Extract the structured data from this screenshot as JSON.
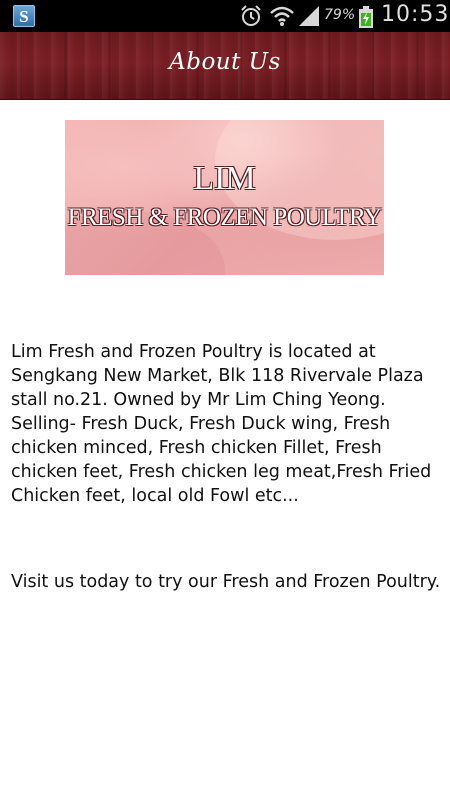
{
  "status_bar": {
    "app_icon_letter": "S",
    "battery_percent": "79%",
    "time": "10:53"
  },
  "header": {
    "title": "About Us"
  },
  "banner": {
    "line1": "LIM",
    "line2": "FRESH & FROZEN POULTRY"
  },
  "content": {
    "about": "Lim Fresh and Frozen Poultry is located at Sengkang New Market, Blk 118 Rivervale Plaza stall no.21. Owned by Mr Lim Ching Yeong. Selling- Fresh Duck, Fresh Duck wing, Fresh chicken minced, Fresh chicken Fillet, Fresh chicken feet, Fresh chicken leg meat,Fresh Fried Chicken feet, local old Fowl etc...",
    "visit": "Visit us today to try our Fresh and Frozen Poultry."
  },
  "colors": {
    "header_background": "#7c2025",
    "banner_pink": "#f3b6b5"
  }
}
